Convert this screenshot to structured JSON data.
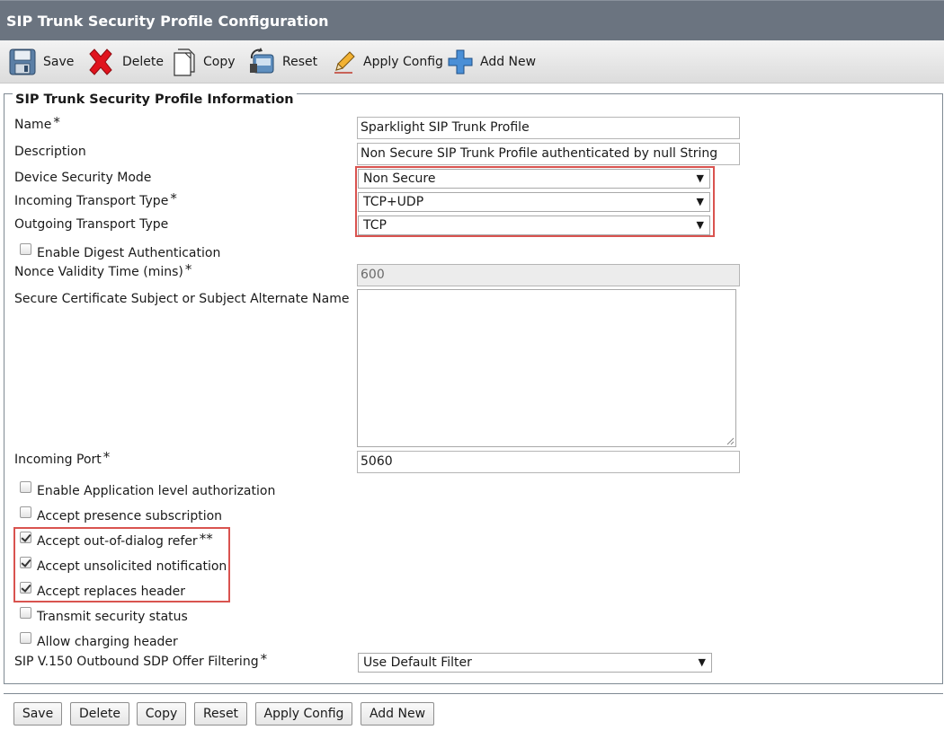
{
  "window": {
    "title": "SIP Trunk Security Profile Configuration"
  },
  "toolbar": {
    "save": "Save",
    "delete": "Delete",
    "copy": "Copy",
    "reset": "Reset",
    "apply_config": "Apply Config",
    "add_new": "Add New"
  },
  "section": {
    "legend": "SIP Trunk Security Profile Information"
  },
  "fields": {
    "name": {
      "label": "Name",
      "value": "Sparklight SIP Trunk Profile",
      "required": "*"
    },
    "description": {
      "label": "Description",
      "value": "Non Secure SIP Trunk Profile authenticated by null String"
    },
    "device_security_mode": {
      "label": "Device Security Mode",
      "value": "Non Secure"
    },
    "incoming_transport_type": {
      "label": "Incoming Transport Type",
      "value": "TCP+UDP",
      "required": "*"
    },
    "outgoing_transport_type": {
      "label": "Outgoing Transport Type",
      "value": "TCP"
    },
    "enable_digest_authentication": {
      "label": "Enable Digest Authentication",
      "checked": false
    },
    "nonce_validity_time": {
      "label": "Nonce Validity Time (mins)",
      "value": "600",
      "required": "*"
    },
    "secure_certificate_subject": {
      "label": "Secure Certificate Subject or Subject Alternate Name",
      "value": ""
    },
    "incoming_port": {
      "label": "Incoming Port",
      "value": "5060",
      "required": "*"
    },
    "enable_app_level_auth": {
      "label": "Enable Application level authorization",
      "checked": false
    },
    "accept_presence_subscription": {
      "label": "Accept presence subscription",
      "checked": false
    },
    "accept_out_of_dialog_refer": {
      "label": "Accept out-of-dialog refer",
      "checked": true,
      "required": "**"
    },
    "accept_unsolicited_notification": {
      "label": "Accept unsolicited notification",
      "checked": true
    },
    "accept_replaces_header": {
      "label": "Accept replaces header",
      "checked": true
    },
    "transmit_security_status": {
      "label": "Transmit security status",
      "checked": false
    },
    "allow_charging_header": {
      "label": "Allow charging header",
      "checked": false
    },
    "sdp_offer_filtering": {
      "label": "SIP V.150 Outbound SDP Offer Filtering",
      "value": "Use Default Filter",
      "required": "*"
    }
  },
  "bottom_buttons": {
    "save": "Save",
    "delete": "Delete",
    "copy": "Copy",
    "reset": "Reset",
    "apply_config": "Apply Config",
    "add_new": "Add New"
  },
  "colors": {
    "titlebar": "#6b7480",
    "highlight": "#d9534f",
    "delete_icon": "#e0141e",
    "add_icon": "#4a8fd6"
  },
  "icons": {
    "save": "floppy-disk-icon",
    "delete": "red-x-icon",
    "copy": "document-copy-icon",
    "reset": "reset-device-icon",
    "apply_config": "pencil-icon",
    "add_new": "plus-icon"
  }
}
